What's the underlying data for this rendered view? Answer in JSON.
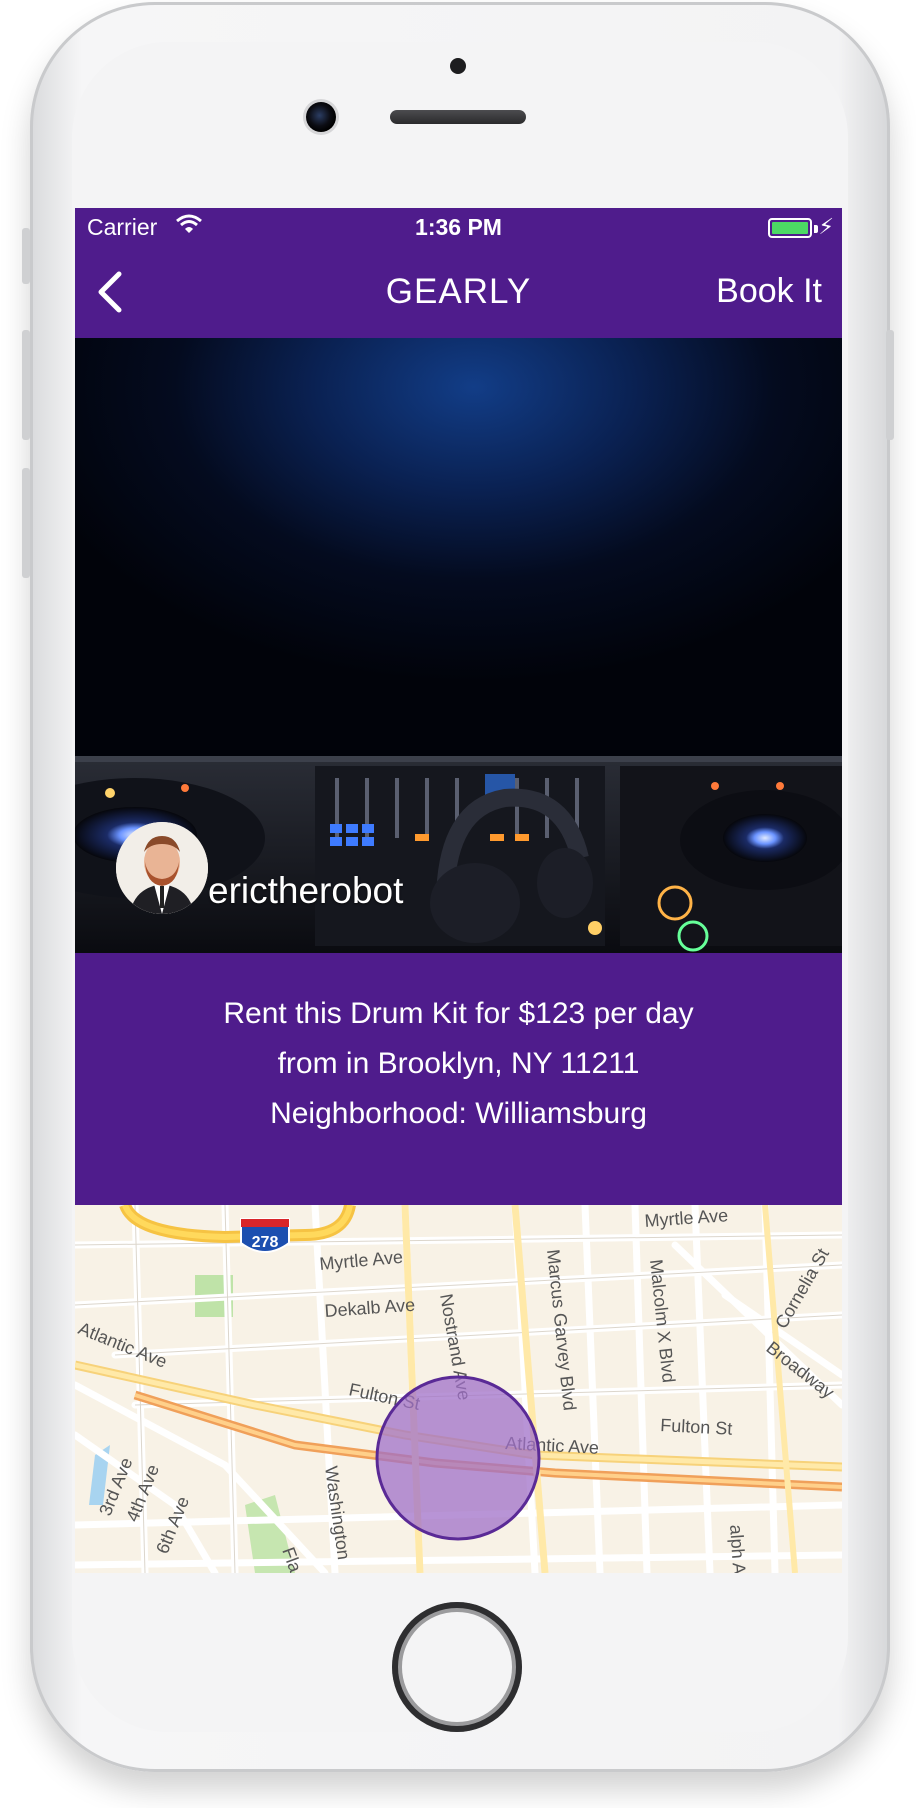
{
  "status_bar": {
    "carrier": "Carrier",
    "time": "1:36 PM",
    "battery_level": 1.0
  },
  "nav": {
    "back_icon": "chevron-left-icon",
    "title": "GEARLY",
    "action_label": "Book It"
  },
  "listing": {
    "owner_username": "erictherobot",
    "description_line1": "Rent this Drum Kit for $123 per day",
    "description_line2": "from  in Brooklyn, NY 11211",
    "description_line3": "Neighborhood: Williamsburg"
  },
  "map": {
    "highway_shield": "278",
    "streets": {
      "myrtle_ave_top": "Myrtle Ave",
      "myrtle_ave": "Myrtle Ave",
      "dekalb_ave": "Dekalb Ave",
      "atlantic_ave_left": "Atlantic Ave",
      "atlantic_ave": "Atlantic Ave",
      "fulton_st_left": "Fulton St",
      "fulton_st_right": "Fulton St",
      "nostrand_ave": "Nostrand Ave",
      "marcus_garvey": "Marcus Garvey Blvd",
      "malcolm_x": "Malcolm X Blvd",
      "cornelia_st": "Cornelia St",
      "broadway": "Broadway",
      "third_ave": "3rd Ave",
      "fourth_ave": "4th Ave",
      "sixth_ave": "6th Ave",
      "washington": "Washington",
      "ralph_ave": "alph Ave",
      "flatbush": "Fla"
    },
    "colors": {
      "area_fill": "#a070c8",
      "area_stroke": "#5a2a96"
    }
  },
  "colors": {
    "brand_purple": "#4f1c8c",
    "battery_green": "#4cd964"
  }
}
